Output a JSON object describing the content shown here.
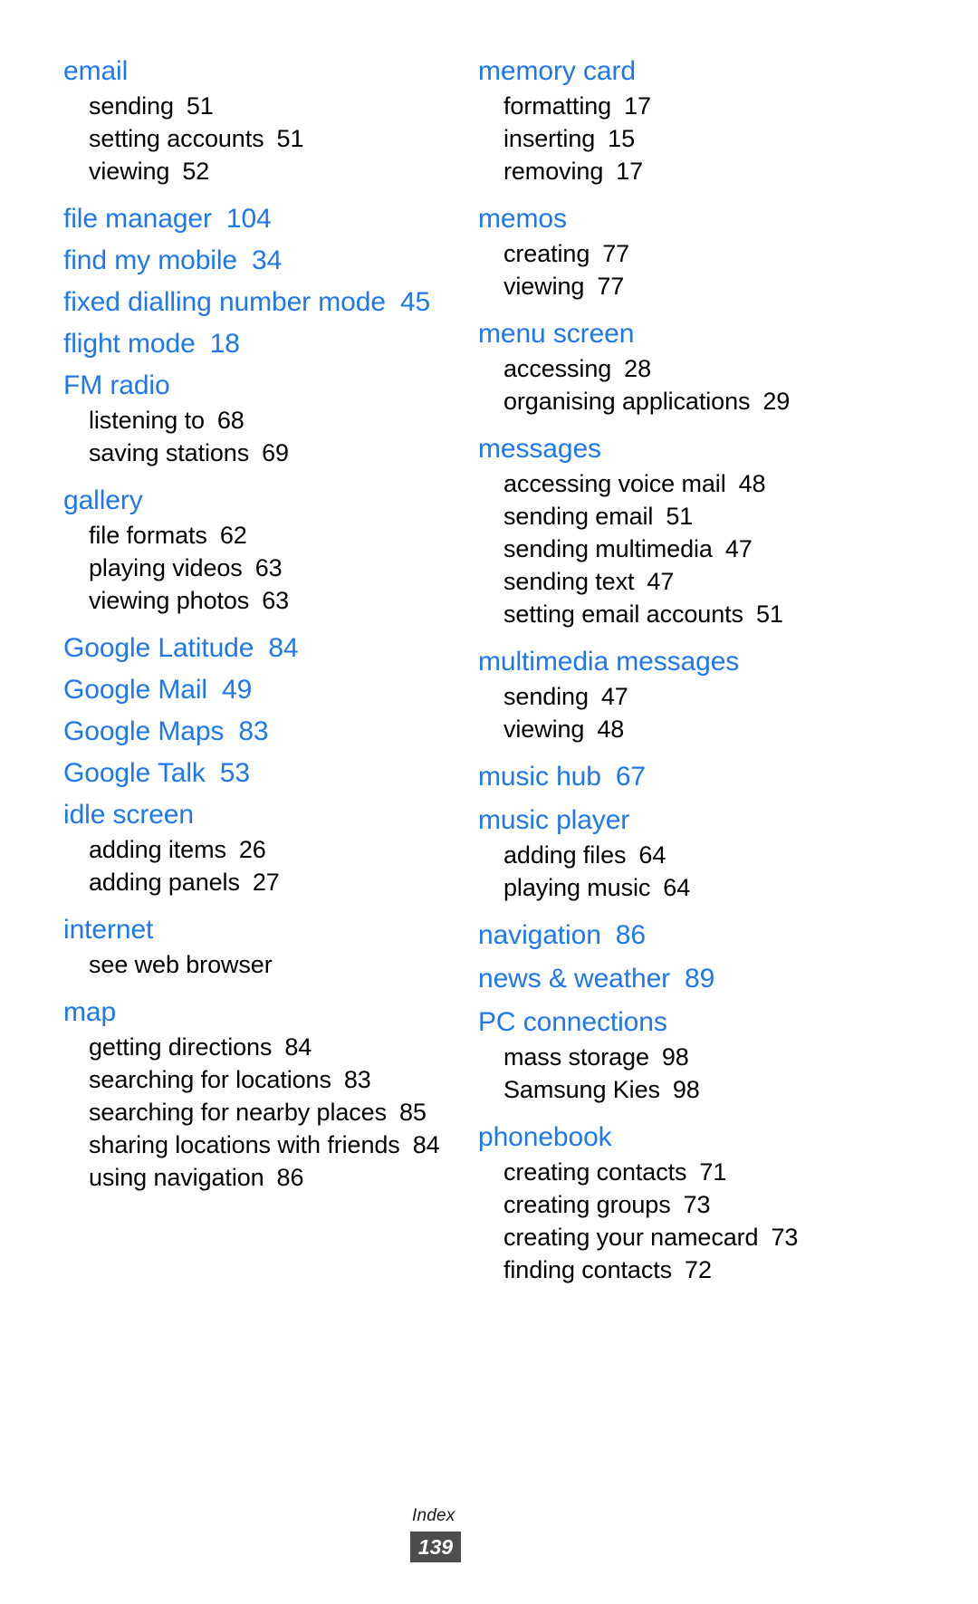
{
  "footer": {
    "label": "Index",
    "page_number": "139"
  },
  "colors": {
    "heading": "#1f77ee",
    "body": "#000000",
    "badge_bg": "#4d4d4d",
    "badge_text": "#ffffff"
  },
  "columns": [
    {
      "id": "left",
      "entries": [
        {
          "term": "email",
          "page": "",
          "subs": [
            {
              "text": "sending",
              "page": "51"
            },
            {
              "text": "setting accounts",
              "page": "51"
            },
            {
              "text": "viewing",
              "page": "52"
            }
          ]
        },
        {
          "term": "file manager",
          "page": "104",
          "subs": []
        },
        {
          "term": "find my mobile",
          "page": "34",
          "subs": []
        },
        {
          "term": "fixed dialling number mode",
          "page": "45",
          "subs": []
        },
        {
          "term": "flight mode",
          "page": "18",
          "subs": []
        },
        {
          "term": "FM radio",
          "page": "",
          "subs": [
            {
              "text": "listening to",
              "page": "68"
            },
            {
              "text": "saving stations",
              "page": "69"
            }
          ]
        },
        {
          "term": "gallery",
          "page": "",
          "subs": [
            {
              "text": "file formats",
              "page": "62"
            },
            {
              "text": "playing videos",
              "page": "63"
            },
            {
              "text": "viewing photos",
              "page": "63"
            }
          ]
        },
        {
          "term": "Google Latitude",
          "page": "84",
          "subs": []
        },
        {
          "term": "Google Mail",
          "page": "49",
          "subs": []
        },
        {
          "term": "Google Maps",
          "page": "83",
          "subs": []
        },
        {
          "term": "Google Talk",
          "page": "53",
          "subs": []
        },
        {
          "term": "idle screen",
          "page": "",
          "subs": [
            {
              "text": "adding items",
              "page": "26"
            },
            {
              "text": "adding panels",
              "page": "27"
            }
          ]
        },
        {
          "term": "internet",
          "page": "",
          "subs": [
            {
              "text": "see web browser",
              "page": ""
            }
          ]
        },
        {
          "term": "map",
          "page": "",
          "subs": [
            {
              "text": "getting directions",
              "page": "84"
            },
            {
              "text": "searching for locations",
              "page": "83"
            },
            {
              "text": "searching for nearby places",
              "page": "85"
            },
            {
              "text": "sharing locations with friends",
              "page": "84"
            },
            {
              "text": "using navigation",
              "page": "86"
            }
          ]
        }
      ]
    },
    {
      "id": "right",
      "entries": [
        {
          "term": "memory card",
          "page": "",
          "subs": [
            {
              "text": "formatting",
              "page": "17"
            },
            {
              "text": "inserting",
              "page": "15"
            },
            {
              "text": "removing",
              "page": "17"
            }
          ]
        },
        {
          "term": "memos",
          "page": "",
          "subs": [
            {
              "text": "creating",
              "page": "77"
            },
            {
              "text": "viewing",
              "page": "77"
            }
          ]
        },
        {
          "term": "menu screen",
          "page": "",
          "subs": [
            {
              "text": "accessing",
              "page": "28"
            },
            {
              "text": "organising applications",
              "page": "29"
            }
          ]
        },
        {
          "term": "messages",
          "page": "",
          "subs": [
            {
              "text": "accessing voice mail",
              "page": "48"
            },
            {
              "text": "sending email",
              "page": "51"
            },
            {
              "text": "sending multimedia",
              "page": "47"
            },
            {
              "text": "sending text",
              "page": "47"
            },
            {
              "text": "setting email accounts",
              "page": "51"
            }
          ]
        },
        {
          "term": "multimedia messages",
          "page": "",
          "subs": [
            {
              "text": "sending",
              "page": "47"
            },
            {
              "text": "viewing",
              "page": "48"
            }
          ]
        },
        {
          "term": "music hub",
          "page": "67",
          "subs": []
        },
        {
          "term": "music player",
          "page": "",
          "subs": [
            {
              "text": "adding files",
              "page": "64"
            },
            {
              "text": "playing music",
              "page": "64"
            }
          ]
        },
        {
          "term": "navigation",
          "page": "86",
          "subs": []
        },
        {
          "term": "news & weather",
          "page": "89",
          "subs": []
        },
        {
          "term": "PC connections",
          "page": "",
          "subs": [
            {
              "text": "mass storage",
              "page": "98"
            },
            {
              "text": "Samsung Kies",
              "page": "98"
            }
          ]
        },
        {
          "term": "phonebook",
          "page": "",
          "subs": [
            {
              "text": "creating contacts",
              "page": "71"
            },
            {
              "text": "creating groups",
              "page": "73"
            },
            {
              "text": "creating your namecard",
              "page": "73"
            },
            {
              "text": "finding contacts",
              "page": "72"
            }
          ]
        }
      ]
    }
  ]
}
